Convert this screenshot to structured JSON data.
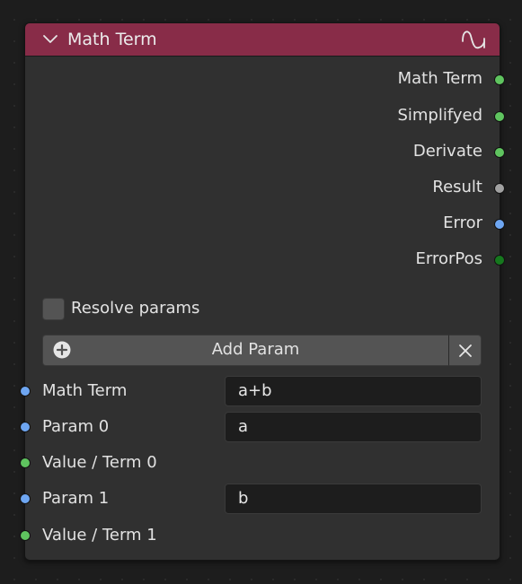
{
  "node": {
    "title": "Math Term",
    "header_color": "#882c48",
    "header_icon": "wave-icon",
    "collapse_icon": "chevron-down-icon"
  },
  "outputs": [
    {
      "label": "Math Term",
      "socket_color": "#5fc45f"
    },
    {
      "label": "Simplifyed",
      "socket_color": "#5fc45f"
    },
    {
      "label": "Derivate",
      "socket_color": "#5fc45f"
    },
    {
      "label": "Result",
      "socket_color": "#a1a1a1"
    },
    {
      "label": "Error",
      "socket_color": "#6ea6f2"
    },
    {
      "label": "ErrorPos",
      "socket_color": "#16781e"
    }
  ],
  "resolve_params": {
    "label": "Resolve params",
    "checked": false
  },
  "add_param": {
    "label": "Add Param",
    "icon": "plus-circle-icon",
    "remove_icon": "close-icon"
  },
  "inputs": [
    {
      "label": "Math Term",
      "socket_color": "#6ea6f2",
      "value": "a+b"
    },
    {
      "label": "Param 0",
      "socket_color": "#6ea6f2",
      "value": "a"
    },
    {
      "label": "Value / Term 0",
      "socket_color": "#5fc45f"
    },
    {
      "label": "Param 1",
      "socket_color": "#6ea6f2",
      "value": "b"
    },
    {
      "label": "Value / Term 1",
      "socket_color": "#5fc45f"
    }
  ]
}
